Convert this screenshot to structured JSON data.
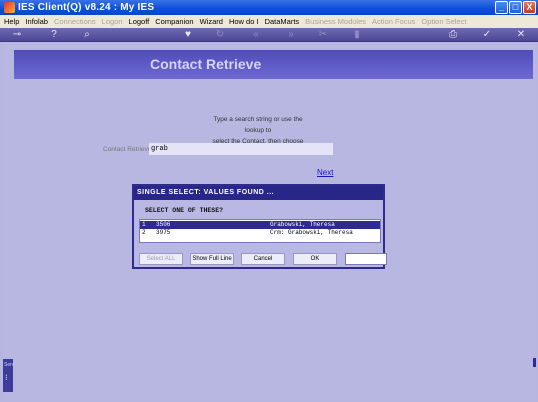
{
  "window": {
    "title": "IES Client(Q) v8.24 : My IES",
    "controls": [
      "_",
      "□",
      "X"
    ]
  },
  "menu": [
    {
      "label": "Help",
      "enabled": true
    },
    {
      "label": "Infolab",
      "enabled": true
    },
    {
      "label": "Connections",
      "enabled": false
    },
    {
      "label": "Logon",
      "enabled": false
    },
    {
      "label": "Logoff",
      "enabled": true
    },
    {
      "label": "Companion",
      "enabled": true
    },
    {
      "label": "Wizard",
      "enabled": true
    },
    {
      "label": "How do I",
      "enabled": true
    },
    {
      "label": "DataMarts",
      "enabled": true
    },
    {
      "label": "Business Modules",
      "enabled": false
    },
    {
      "label": "Action Focus",
      "enabled": false
    },
    {
      "label": "Option Select",
      "enabled": false
    }
  ],
  "toolbar": {
    "icons": [
      "key-icon",
      "help-icon",
      "search-icon",
      "heart-icon",
      "refresh-icon",
      "rewind-icon",
      "forward-icon",
      "cut-icon",
      "copy-icon",
      "print-icon",
      "ok-icon",
      "close-icon"
    ]
  },
  "page": {
    "title": "Contact Retrieve",
    "instruction_line1": "Type a search string or use the lookup to",
    "instruction_line2": "select the Contact, then choose NEXT.",
    "field_label": "Contact Retrieve",
    "field_value": "grab",
    "next_label": "Next"
  },
  "dialog": {
    "title": "SINGLE SELECT: VALUES FOUND ...",
    "subtitle": "SELECT ONE OF THESE?",
    "rows": [
      {
        "num": "1",
        "code": "3506",
        "name": "Grabowski, Theresa",
        "selected": true
      },
      {
        "num": "2",
        "code": "3975",
        "name": "Crm: Grabowski, Theresa",
        "selected": false
      }
    ],
    "buttons": {
      "select_all": "Select ALL",
      "show_full_line": "Show Full Line",
      "cancel": "Cancel",
      "ok": "OK"
    }
  },
  "side_tab": {
    "label": "Serv"
  },
  "colors": {
    "background": "#b8b7e2",
    "banner": "#4f4bbb",
    "dialog_header": "#29268a",
    "selected_row": "#2e2b8f",
    "link": "#1515c8"
  }
}
